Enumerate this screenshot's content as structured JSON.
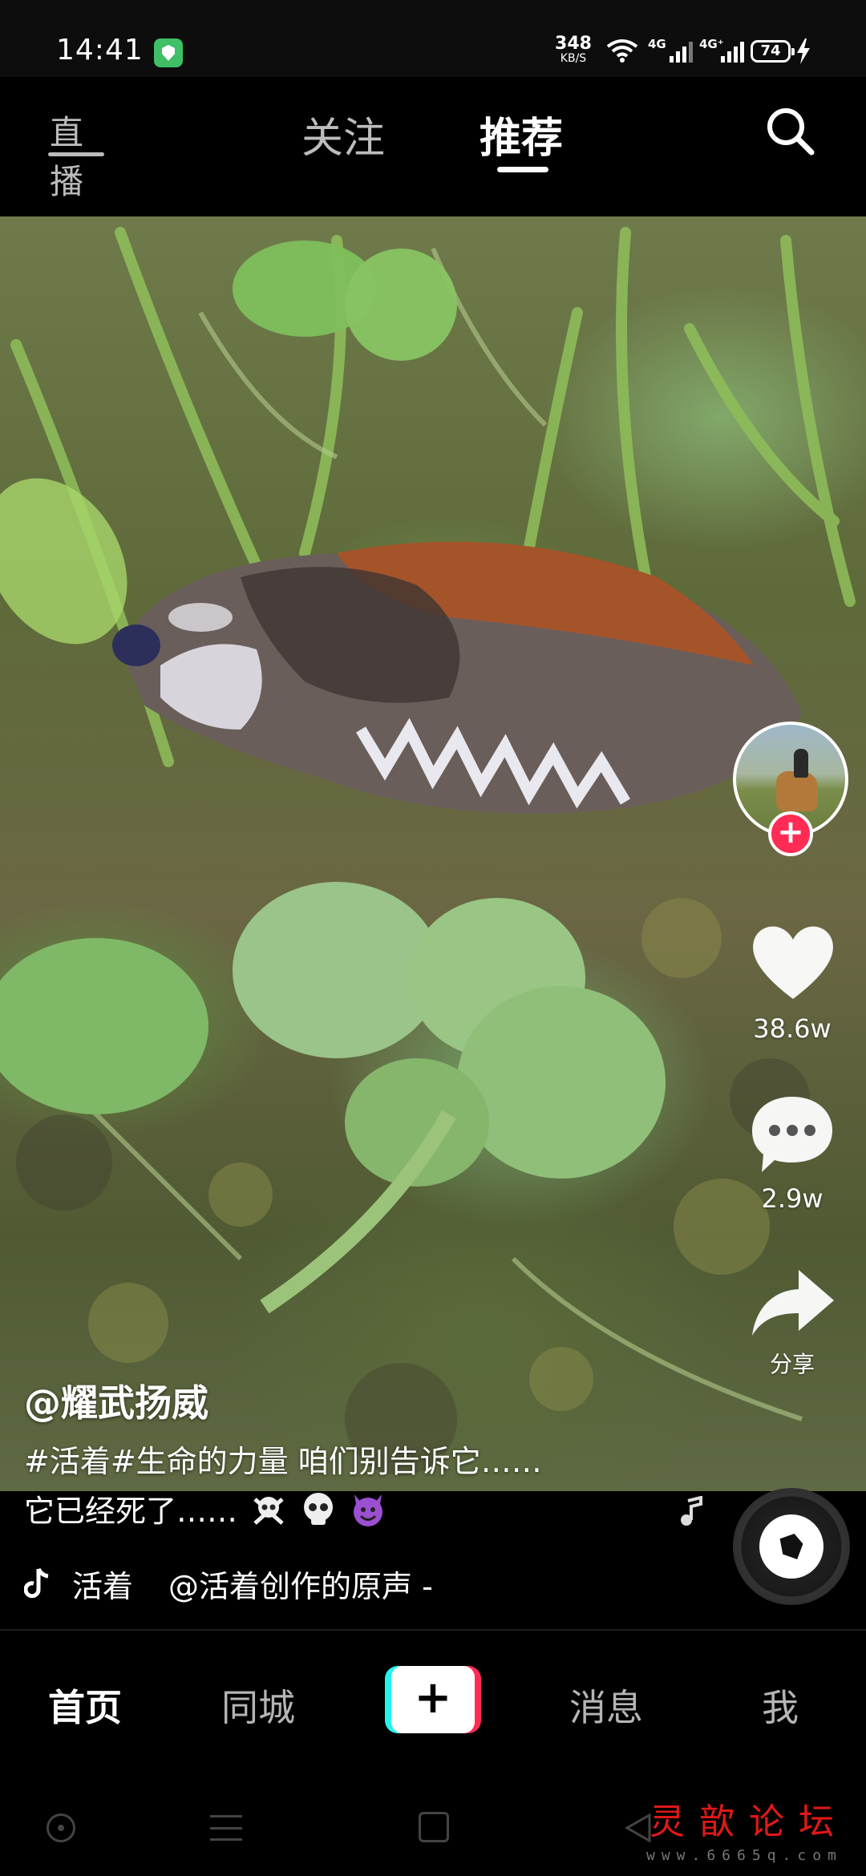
{
  "status_bar": {
    "time": "14:41",
    "net_speed_value": "348",
    "net_speed_unit": "KB/S",
    "signal_1_label": "4G",
    "signal_2_label": "4G⁺",
    "battery": "74",
    "icons": [
      "shield-icon",
      "wifi-icon",
      "signal-icon",
      "battery-icon",
      "charging-icon"
    ]
  },
  "top_nav": {
    "live_label": "直播",
    "tabs": [
      {
        "label": "关注",
        "active": false
      },
      {
        "label": "推荐",
        "active": true
      }
    ],
    "search_icon": "search-icon"
  },
  "video": {
    "author": "@耀武扬威",
    "caption_line1": "#活着#生命的力量 咱们别告诉它……",
    "caption_line2": "它已经死了……",
    "caption_emojis": [
      "skull-crossbones",
      "skull",
      "smiling-imp"
    ],
    "music": "活着",
    "music_source": "@活着创作的原声 -"
  },
  "actions": {
    "like_count": "38.6w",
    "comment_count": "2.9w",
    "share_label": "分享",
    "follow_icon": "plus-icon"
  },
  "bottom_nav": {
    "tabs": [
      {
        "label": "首页",
        "active": true
      },
      {
        "label": "同城",
        "active": false
      },
      {
        "label": "+",
        "active": false
      },
      {
        "label": "消息",
        "active": false
      },
      {
        "label": "我",
        "active": false
      }
    ]
  },
  "watermark": {
    "text": "灵歆论坛",
    "url": "www.6665q.com"
  },
  "colors": {
    "accent_red": "#fe2c55",
    "accent_cyan": "#25f4ee",
    "background": "#000000",
    "shield_green": "#3fbf66",
    "watermark_red": "#e01818"
  }
}
